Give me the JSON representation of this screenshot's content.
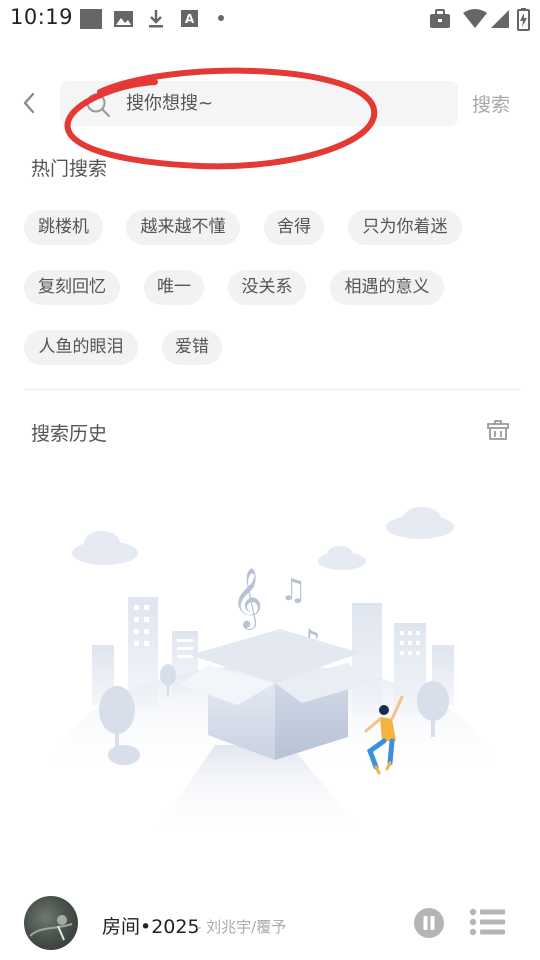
{
  "status_bar": {
    "time": "10:19",
    "left_icons": [
      "notification-square-icon",
      "image-icon",
      "download-icon",
      "font-a-icon",
      "dot-icon"
    ],
    "right_icons": [
      "briefcase-icon",
      "wifi-icon",
      "signal-icon",
      "battery-charging-icon"
    ]
  },
  "search": {
    "placeholder": "搜你想搜~",
    "value": "",
    "submit_label": "搜索",
    "annotation_color": "#e53935"
  },
  "hot_search": {
    "title": "热门搜索",
    "tags": [
      "跳楼机",
      "越来越不懂",
      "舍得",
      "只为你着迷",
      "复刻回忆",
      "唯一",
      "没关系",
      "相遇的意义",
      "人鱼的眼泪",
      "爱错"
    ]
  },
  "history": {
    "title": "搜索历史",
    "clear_icon": "trash-basket-icon"
  },
  "player": {
    "title": "房间•2025",
    "artist": "- 刘兆宇/覆予",
    "play_state": "playing",
    "pause_icon": "pause-icon",
    "playlist_icon": "playlist-icon"
  },
  "colors": {
    "tag_bg": "#f2f2f2",
    "accent_annotation": "#e53935",
    "illustration_blue": "#d5dcea"
  }
}
